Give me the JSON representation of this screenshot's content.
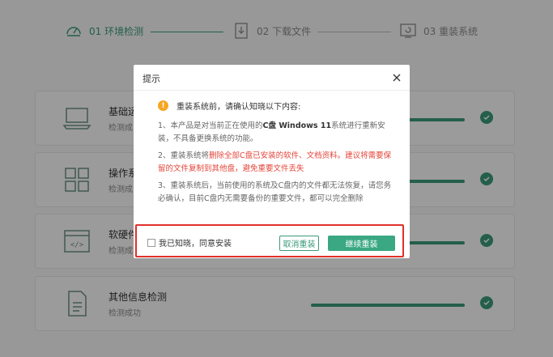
{
  "stepper": {
    "steps": [
      {
        "label": "01 环境检测",
        "icon": "speedometer-icon",
        "active": true
      },
      {
        "label": "02 下载文件",
        "icon": "download-file-icon",
        "active": false
      },
      {
        "label": "03 重装系统",
        "icon": "reinstall-icon",
        "active": false
      }
    ]
  },
  "checks": [
    {
      "title": "基础运",
      "status": "检测成",
      "icon": "laptop-icon"
    },
    {
      "title": "操作系",
      "status": "检测成",
      "icon": "grid-apps-icon"
    },
    {
      "title": "软硬件",
      "status": "检测成",
      "icon": "code-window-icon"
    },
    {
      "title": "其他信息检测",
      "status": "检测成功",
      "icon": "document-icon"
    }
  ],
  "dialog": {
    "title": "提示",
    "warning": "重装系统前，请确认知晓以下内容:",
    "item1_pre": "1、本产品是对当前正在使用的",
    "item1_bold": "C盘 Windows 11",
    "item1_post": "系统进行重新安装，不具备更换系统的功能。",
    "item2_pre": "2、重装系统将",
    "item2_red": "删除全部C盘已安装的软件、文档资料。建议将需要保留的文件复制到其他盘，避免重要文件丢失",
    "item3": "3、重装系统后，当前使用的系统及C盘内的文件都无法恢复，请您务必确认，目前C盘内无需要备份的重要文件，都可以完全删除",
    "agree_label": "我已知晓，同意安装",
    "cancel_label": "取消重装",
    "continue_label": "继续重装"
  },
  "colors": {
    "accent": "#3a9a7a",
    "warning": "#f5a623",
    "danger": "#e5453a",
    "highlight_border": "#e0302b"
  }
}
